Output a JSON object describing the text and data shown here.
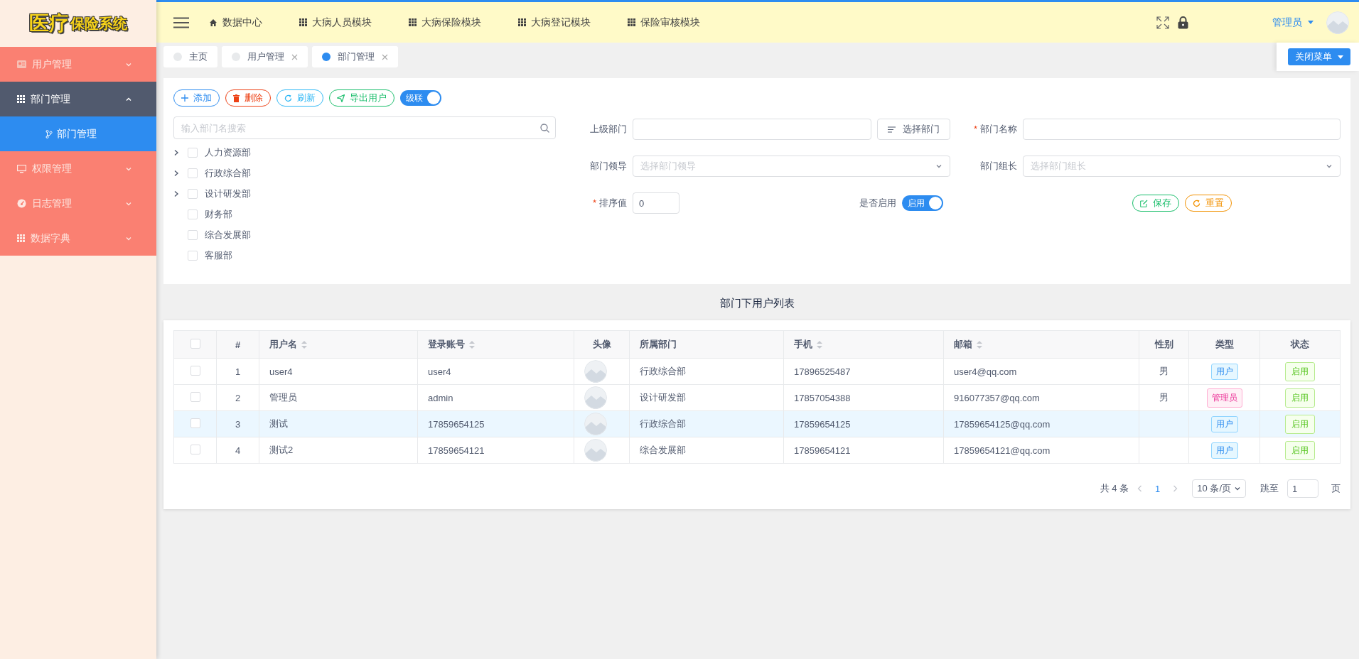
{
  "logo": {
    "main": "医疗",
    "sub": "保险系统"
  },
  "header": {
    "nav": [
      {
        "label": "数据中心",
        "kind": "home"
      },
      {
        "label": "大病人员模块",
        "kind": "module"
      },
      {
        "label": "大病保险模块",
        "kind": "module"
      },
      {
        "label": "大病登记模块",
        "kind": "module"
      },
      {
        "label": "保险审核模块",
        "kind": "module"
      }
    ],
    "user": "管理员"
  },
  "sidebar": {
    "items": [
      {
        "label": "用户管理",
        "expanded": false
      },
      {
        "label": "部门管理",
        "expanded": true,
        "children": [
          {
            "label": "部门管理",
            "selected": true
          }
        ]
      },
      {
        "label": "权限管理",
        "expanded": false
      },
      {
        "label": "日志管理",
        "expanded": false
      },
      {
        "label": "数据字典",
        "expanded": false
      }
    ]
  },
  "tabs": [
    {
      "label": "主页",
      "selected": false,
      "closable": false
    },
    {
      "label": "用户管理",
      "selected": false,
      "closable": true
    },
    {
      "label": "部门管理",
      "selected": true,
      "closable": true
    }
  ],
  "close_menu_button": "关闭菜单",
  "toolbar": {
    "buttons": [
      {
        "label": "添加",
        "kind": "add"
      },
      {
        "label": "删除",
        "kind": "delete"
      },
      {
        "label": "刷新",
        "kind": "refresh"
      },
      {
        "label": "导出用户",
        "kind": "export"
      }
    ],
    "cascade": {
      "label": "级联",
      "on": true
    }
  },
  "tree": {
    "search_placeholder": "输入部门名搜索",
    "nodes": [
      {
        "label": "人力资源部",
        "kind": "branch",
        "checked": false
      },
      {
        "label": "行政综合部",
        "kind": "branch",
        "checked": false
      },
      {
        "label": "设计研发部",
        "kind": "branch",
        "checked": false
      },
      {
        "label": "财务部",
        "kind": "leaf",
        "checked": false
      },
      {
        "label": "综合发展部",
        "kind": "leaf",
        "checked": false
      },
      {
        "label": "客服部",
        "kind": "leaf",
        "checked": false
      }
    ]
  },
  "form": {
    "rows": [
      {
        "cells": [
          {
            "fields": [
              {
                "kind": "text",
                "label": "上级部门",
                "button": "选择部门"
              }
            ]
          },
          {
            "fields": [
              {
                "kind": "text",
                "label": "部门名称",
                "required_mark": "*"
              }
            ]
          }
        ]
      },
      {
        "cells": [
          {
            "fields": [
              {
                "kind": "select",
                "label": "部门领导",
                "placeholder": "选择部门领导"
              }
            ]
          },
          {
            "fields": [
              {
                "kind": "select",
                "label": "部门组长",
                "placeholder": "选择部门组长"
              }
            ]
          }
        ]
      },
      {
        "cells": [
          {
            "fields": [
              {
                "kind": "number",
                "label": "排序值",
                "required_mark": "*",
                "value": "0"
              },
              {
                "kind": "switch",
                "label": "是否启用",
                "on": true,
                "text": "启用"
              }
            ]
          },
          {
            "fields": [
              {
                "kind": "actions",
                "buttons": [
                  {
                    "label": "保存",
                    "kind": "save"
                  },
                  {
                    "label": "重置",
                    "kind": "reset"
                  }
                ]
              }
            ]
          }
        ]
      }
    ]
  },
  "table": {
    "title": "部门下用户列表",
    "all_checked": false,
    "columns": [
      {
        "kind": "checkbox"
      },
      {
        "label": "#",
        "sortable": false
      },
      {
        "label": "用户名",
        "sortable": true
      },
      {
        "label": "登录账号",
        "sortable": true
      },
      {
        "label": "头像",
        "sortable": false
      },
      {
        "label": "所属部门",
        "sortable": false
      },
      {
        "label": "手机",
        "sortable": true
      },
      {
        "label": "邮箱",
        "sortable": true
      },
      {
        "label": "性别",
        "sortable": false
      },
      {
        "label": "类型",
        "sortable": false
      },
      {
        "label": "状态",
        "sortable": false
      }
    ],
    "rows": [
      {
        "checked": false,
        "highlighted": false,
        "index": "1",
        "username": "user4",
        "account": "user4",
        "department": "行政综合部",
        "phone": "17896525487",
        "email": "user4@qq.com",
        "gender": "男",
        "type": {
          "label": "用户",
          "kind": "user"
        },
        "status": {
          "label": "启用",
          "kind": "enabled"
        }
      },
      {
        "checked": false,
        "highlighted": false,
        "index": "2",
        "username": "管理员",
        "account": "admin",
        "department": "设计研发部",
        "phone": "17857054388",
        "email": "916077357@qq.com",
        "gender": "男",
        "type": {
          "label": "管理员",
          "kind": "admin"
        },
        "status": {
          "label": "启用",
          "kind": "enabled"
        }
      },
      {
        "checked": false,
        "highlighted": true,
        "index": "3",
        "username": "测试",
        "account": "17859654125",
        "department": "行政综合部",
        "phone": "17859654125",
        "email": "17859654125@qq.com",
        "type": {
          "label": "用户",
          "kind": "user"
        },
        "status": {
          "label": "启用",
          "kind": "enabled"
        }
      },
      {
        "checked": false,
        "highlighted": false,
        "index": "4",
        "username": "测试2",
        "account": "17859654121",
        "department": "综合发展部",
        "phone": "17859654121",
        "email": "17859654121@qq.com",
        "type": {
          "label": "用户",
          "kind": "user"
        },
        "status": {
          "label": "启用",
          "kind": "enabled"
        }
      }
    ]
  },
  "pagination": {
    "total": "共 4 条",
    "pages": [
      {
        "label": "1",
        "selected": true
      }
    ],
    "page_size": "10 条/页",
    "jump_label": "跳至",
    "jump_value": "1",
    "jump_suffix": "页"
  }
}
